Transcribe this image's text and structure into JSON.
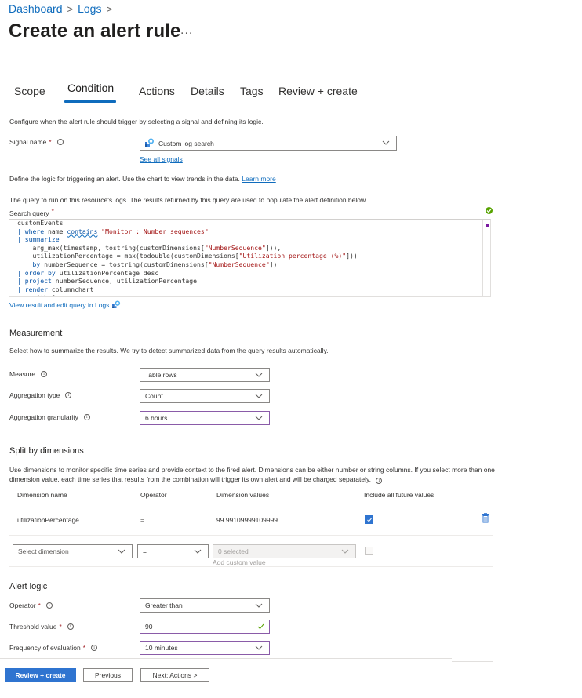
{
  "breadcrumb": {
    "items": [
      "Dashboard",
      "Logs"
    ],
    "separator": ">"
  },
  "header": {
    "title": "Create an alert rule",
    "more_label": "..."
  },
  "tabs": [
    {
      "label": "Scope",
      "active": false
    },
    {
      "label": "Condition",
      "active": true
    },
    {
      "label": "Actions",
      "active": false
    },
    {
      "label": "Details",
      "active": false
    },
    {
      "label": "Tags",
      "active": false
    },
    {
      "label": "Review + create",
      "active": false
    }
  ],
  "condition": {
    "intro": "Configure when the alert rule should trigger by selecting a signal and defining its logic.",
    "signal_name_label": "Signal name",
    "required_mark": "*",
    "signal_value": "Custom log search",
    "see_all_signals": "See all signals",
    "logic_text": "Define the logic for triggering an alert. Use the chart to view trends in the data.",
    "learn_more": "Learn more",
    "query_text": "The query to run on this resource's logs. The results returned by this query are used to populate the alert definition below.",
    "search_query_label": "Search query",
    "query_lines": [
      "customEvents",
      "| where name contains \"Monitor : Number sequences\"",
      "| summarize",
      "    arg_max(timestamp, tostring(customDimensions[\"NumberSequence\"])),",
      "    utilizationPercentage = max(todouble(customDimensions[\"Utilization percentage (%)\"]))",
      "    by numberSequence = tostring(customDimensions[\"NumberSequence\"])",
      "| order by utilizationPercentage desc",
      "| project numberSequence, utilizationPercentage",
      "| render columnchart",
      "    with ("
    ],
    "view_in_logs": "View result and edit query in Logs",
    "query_status": "valid"
  },
  "measurement": {
    "title": "Measurement",
    "description": "Select how to summarize the results. We try to detect summarized data from the query results automatically.",
    "measure_label": "Measure",
    "measure_value": "Table rows",
    "aggregation_type_label": "Aggregation type",
    "aggregation_type_value": "Count",
    "aggregation_granularity_label": "Aggregation granularity",
    "aggregation_granularity_value": "6 hours"
  },
  "dimensions": {
    "title": "Split by dimensions",
    "description": "Use dimensions to monitor specific time series and provide context to the fired alert. Dimensions can be either number or string columns. If you select more than one dimension value, each time series that results from the combination will trigger its own alert and will be charged separately.",
    "columns": [
      "Dimension name",
      "Operator",
      "Dimension values",
      "Include all future values"
    ],
    "rows": [
      {
        "name": "utilizationPercentage",
        "operator": "=",
        "values": "99.99109999109999",
        "include_future": true
      }
    ],
    "new_row": {
      "dimension_placeholder": "Select dimension",
      "operator_value": "=",
      "values_placeholder": "0 selected",
      "add_custom_value": "Add custom value",
      "include_future": false
    }
  },
  "alert_logic": {
    "title": "Alert logic",
    "operator_label": "Operator",
    "operator_value": "Greater than",
    "threshold_label": "Threshold value",
    "threshold_value": "90",
    "frequency_label": "Frequency of evaluation",
    "frequency_value": "10 minutes"
  },
  "footer": {
    "review_create": "Review + create",
    "previous": "Previous",
    "next": "Next: Actions >"
  },
  "colors": {
    "accent": "#0f6cbd",
    "primary_button": "#2f74d0",
    "success": "#57a300",
    "focus_border": "#8a5ba8"
  }
}
